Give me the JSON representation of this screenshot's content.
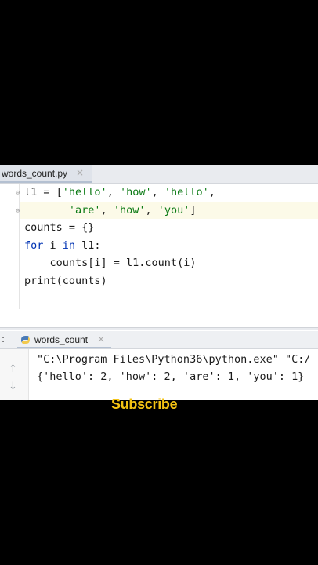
{
  "editor": {
    "tab_label": "words_count.py",
    "tab_close": "×",
    "code_lines": [
      [
        {
          "t": "l1 = [",
          "c": ""
        },
        {
          "t": "'hello'",
          "c": "str"
        },
        {
          "t": ", ",
          "c": ""
        },
        {
          "t": "'how'",
          "c": "str"
        },
        {
          "t": ", ",
          "c": ""
        },
        {
          "t": "'hello'",
          "c": "str"
        },
        {
          "t": ",",
          "c": ""
        }
      ],
      [
        {
          "t": "       ",
          "c": ""
        },
        {
          "t": "'are'",
          "c": "str"
        },
        {
          "t": ", ",
          "c": ""
        },
        {
          "t": "'how'",
          "c": "str"
        },
        {
          "t": ", ",
          "c": ""
        },
        {
          "t": "'you'",
          "c": "str"
        },
        {
          "t": "]",
          "c": ""
        }
      ],
      [
        {
          "t": "counts = {}",
          "c": ""
        }
      ],
      [
        {
          "t": "for",
          "c": "kw"
        },
        {
          "t": " i ",
          "c": ""
        },
        {
          "t": "in",
          "c": "kw"
        },
        {
          "t": " l1:",
          "c": ""
        }
      ],
      [
        {
          "t": "    counts[i] = l1.count(i)",
          "c": ""
        }
      ],
      [
        {
          "t": "print(counts)",
          "c": ""
        }
      ]
    ]
  },
  "run_panel": {
    "colon": ":",
    "tab_label": "words_count",
    "tab_close": "×",
    "up_arrow": "↑",
    "down_arrow": "↓",
    "command_line": "\"C:\\Program Files\\Python36\\python.exe\" \"C:/",
    "output_line": "{'hello': 2, 'how': 2, 'are': 1, 'you': 1}"
  },
  "overlay": {
    "subscribe": "Subscribe"
  },
  "colors": {
    "string": "#0b7a14",
    "keyword": "#0033b3",
    "subscribe": "#f4c313"
  }
}
